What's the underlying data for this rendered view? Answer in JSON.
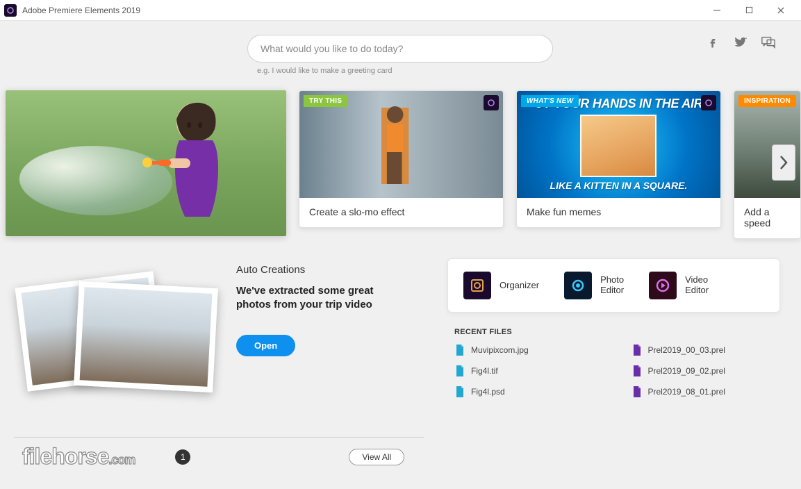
{
  "titlebar": {
    "title": "Adobe Premiere Elements 2019"
  },
  "search": {
    "placeholder": "What would you like to do today?",
    "hint": "e.g. I would like to make a greeting card"
  },
  "cards": {
    "slomo": {
      "badge": "TRY THIS",
      "label": "Create a slo-mo effect"
    },
    "memes": {
      "badge": "WHAT'S NEW",
      "label": "Make fun memes",
      "top": "UT YOUR HANDS IN THE AIR",
      "bot": "LIKE A KITTEN IN A SQUARE."
    },
    "speed": {
      "badge": "INSPIRATION",
      "label": "Add a speed"
    }
  },
  "auto": {
    "heading": "Auto Creations",
    "blurb": "We've extracted some great photos from your trip video",
    "open": "Open"
  },
  "launchers": {
    "organizer": "Organizer",
    "photo_l1": "Photo",
    "photo_l2": "Editor",
    "video_l1": "Video",
    "video_l2": "Editor"
  },
  "recent": {
    "title": "RECENT FILES",
    "files": {
      "f0": "Muvipixcom.jpg",
      "f1": "Prel2019_00_03.prel",
      "f2": "Fig4l.tif",
      "f3": "Prel2019_09_02.prel",
      "f4": "Fig4l.psd",
      "f5": "Prel2019_08_01.prel"
    }
  },
  "bottom": {
    "page": "1",
    "viewall": "View All"
  },
  "watermark": {
    "a": "filehorse",
    "b": ".com"
  }
}
